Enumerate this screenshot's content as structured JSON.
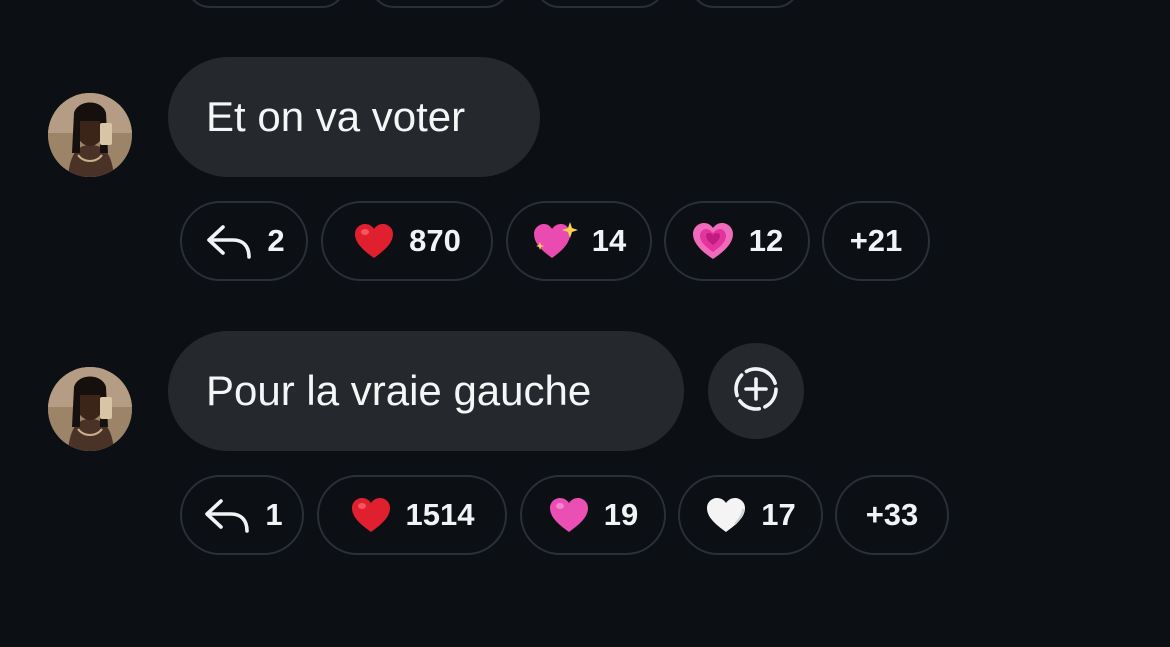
{
  "messages": [
    {
      "text": "Et on va voter",
      "avatar_icon": "user-avatar",
      "reply_count": "2",
      "reactions": [
        {
          "icon": "red-heart-icon",
          "count": "870"
        },
        {
          "icon": "sparkling-heart-icon",
          "count": "14"
        },
        {
          "icon": "growing-heart-icon",
          "count": "12"
        }
      ],
      "more_reactions": "+21"
    },
    {
      "text": "Pour la vraie gauche",
      "avatar_icon": "user-avatar",
      "reply_count": "1",
      "reactions": [
        {
          "icon": "red-heart-icon",
          "count": "1514"
        },
        {
          "icon": "pink-heart-icon",
          "count": "19"
        },
        {
          "icon": "white-heart-icon",
          "count": "17"
        }
      ],
      "more_reactions": "+33",
      "add_reaction_icon": "add-reaction-icon"
    }
  ],
  "colors": {
    "background": "#0c0f14",
    "bubble": "#25282d",
    "pill_border": "#2b2f36",
    "text": "#f2f3f5",
    "red_heart": "#e0202f",
    "pink_heart": "#ea4fb4",
    "white_heart": "#f4f4f4"
  }
}
